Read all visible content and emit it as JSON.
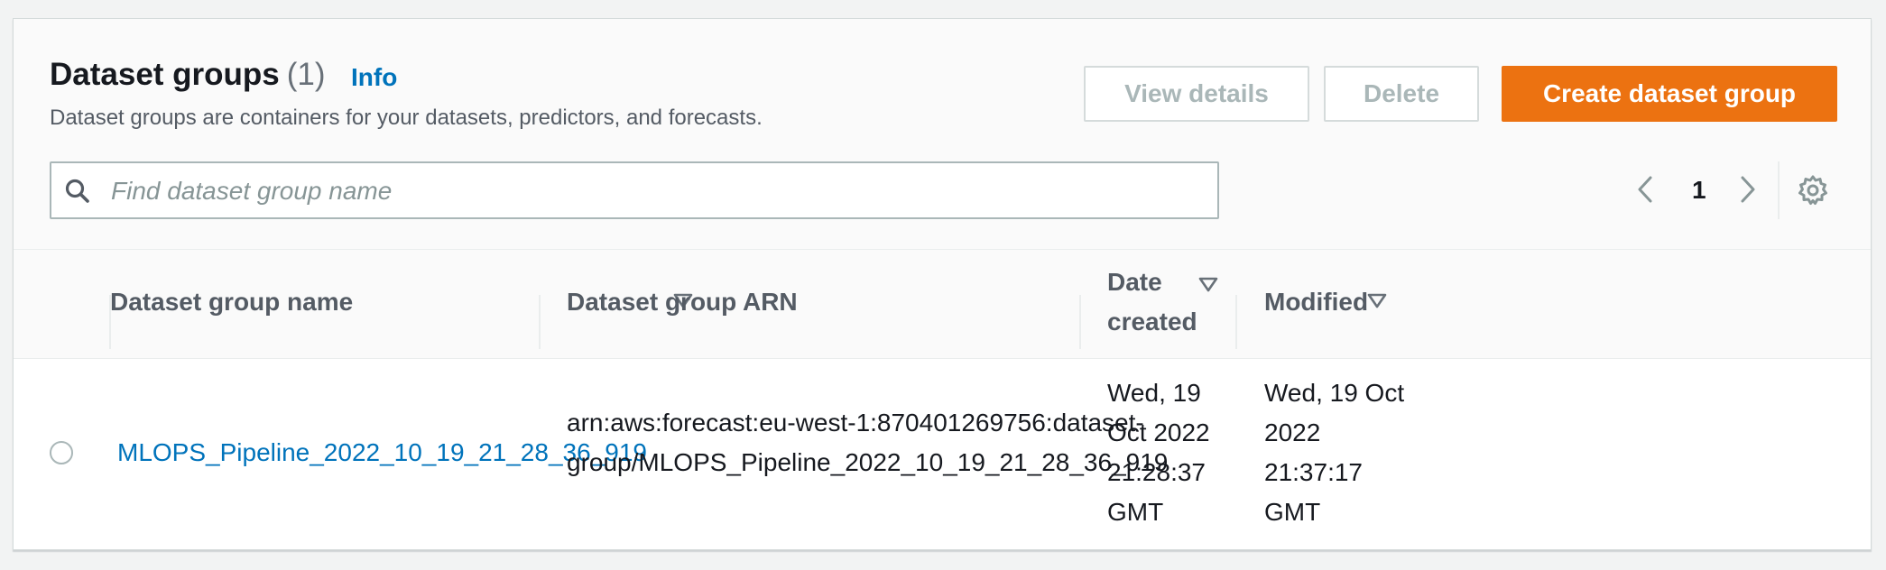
{
  "header": {
    "title": "Dataset groups",
    "count": "(1)",
    "info_label": "Info",
    "description": "Dataset groups are containers for your datasets, predictors, and forecasts."
  },
  "actions": {
    "view_details": "View details",
    "delete": "Delete",
    "create": "Create dataset group"
  },
  "search": {
    "placeholder": "Find dataset group name",
    "value": ""
  },
  "pagination": {
    "current_page": "1"
  },
  "icons": {
    "search": "search-icon",
    "prev": "chevron-left-icon",
    "next": "chevron-right-icon",
    "settings": "gear-icon",
    "sort": "caret-down-outline-icon"
  },
  "columns": {
    "name": "Dataset group name",
    "arn": "Dataset group ARN",
    "date_created_line1": "Date",
    "date_created_line2": "created",
    "modified": "Modified"
  },
  "rows": [
    {
      "selected": false,
      "name": "MLOPS_Pipeline_2022_10_19_21_28_36_919",
      "arn_line1": "arn:aws:forecast:eu-west-1:870401269756:dataset-",
      "arn_line2": "group/MLOPS_Pipeline_2022_10_19_21_28_36_919",
      "date_created_lines": [
        "Wed, 19",
        "Oct 2022",
        "21:28:37",
        "GMT"
      ],
      "modified_lines": [
        "Wed, 19 Oct",
        "2022",
        "21:37:17",
        "GMT"
      ]
    }
  ],
  "colors": {
    "primary": "#ec7211",
    "link": "#0073bb",
    "disabled_text": "#aab7b8",
    "border": "#d5dbdb"
  }
}
